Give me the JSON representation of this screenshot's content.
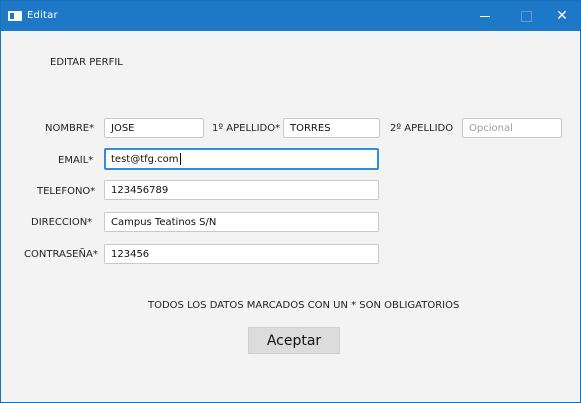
{
  "window": {
    "title": "Editar",
    "controls": {
      "minimize": "—",
      "maximize": "",
      "close": "✕"
    }
  },
  "form": {
    "heading": "EDITAR PERFIL",
    "nombre": {
      "label": "NOMBRE*",
      "value": "JOSE"
    },
    "apellido1": {
      "label": "1º APELLIDO*",
      "value": "TORRES"
    },
    "apellido2": {
      "label": "2º APELLIDO",
      "placeholder": "Opcional"
    },
    "email": {
      "label": "EMAIL*",
      "value": "test@tfg.com"
    },
    "telefono": {
      "label": "TELEFONO*",
      "value": "123456789"
    },
    "direccion": {
      "label": "DIRECCION*",
      "value": "Campus Teatinos S/N"
    },
    "contrasena": {
      "label": "CONTRASEÑA*",
      "value": "123456"
    },
    "note": "TODOS LOS DATOS MARCADOS CON UN * SON OBLIGATORIOS",
    "submit_label": "Aceptar"
  },
  "colors": {
    "titlebar": "#1e78c8",
    "focus": "#2f8cde",
    "background": "#f3f3f3"
  }
}
